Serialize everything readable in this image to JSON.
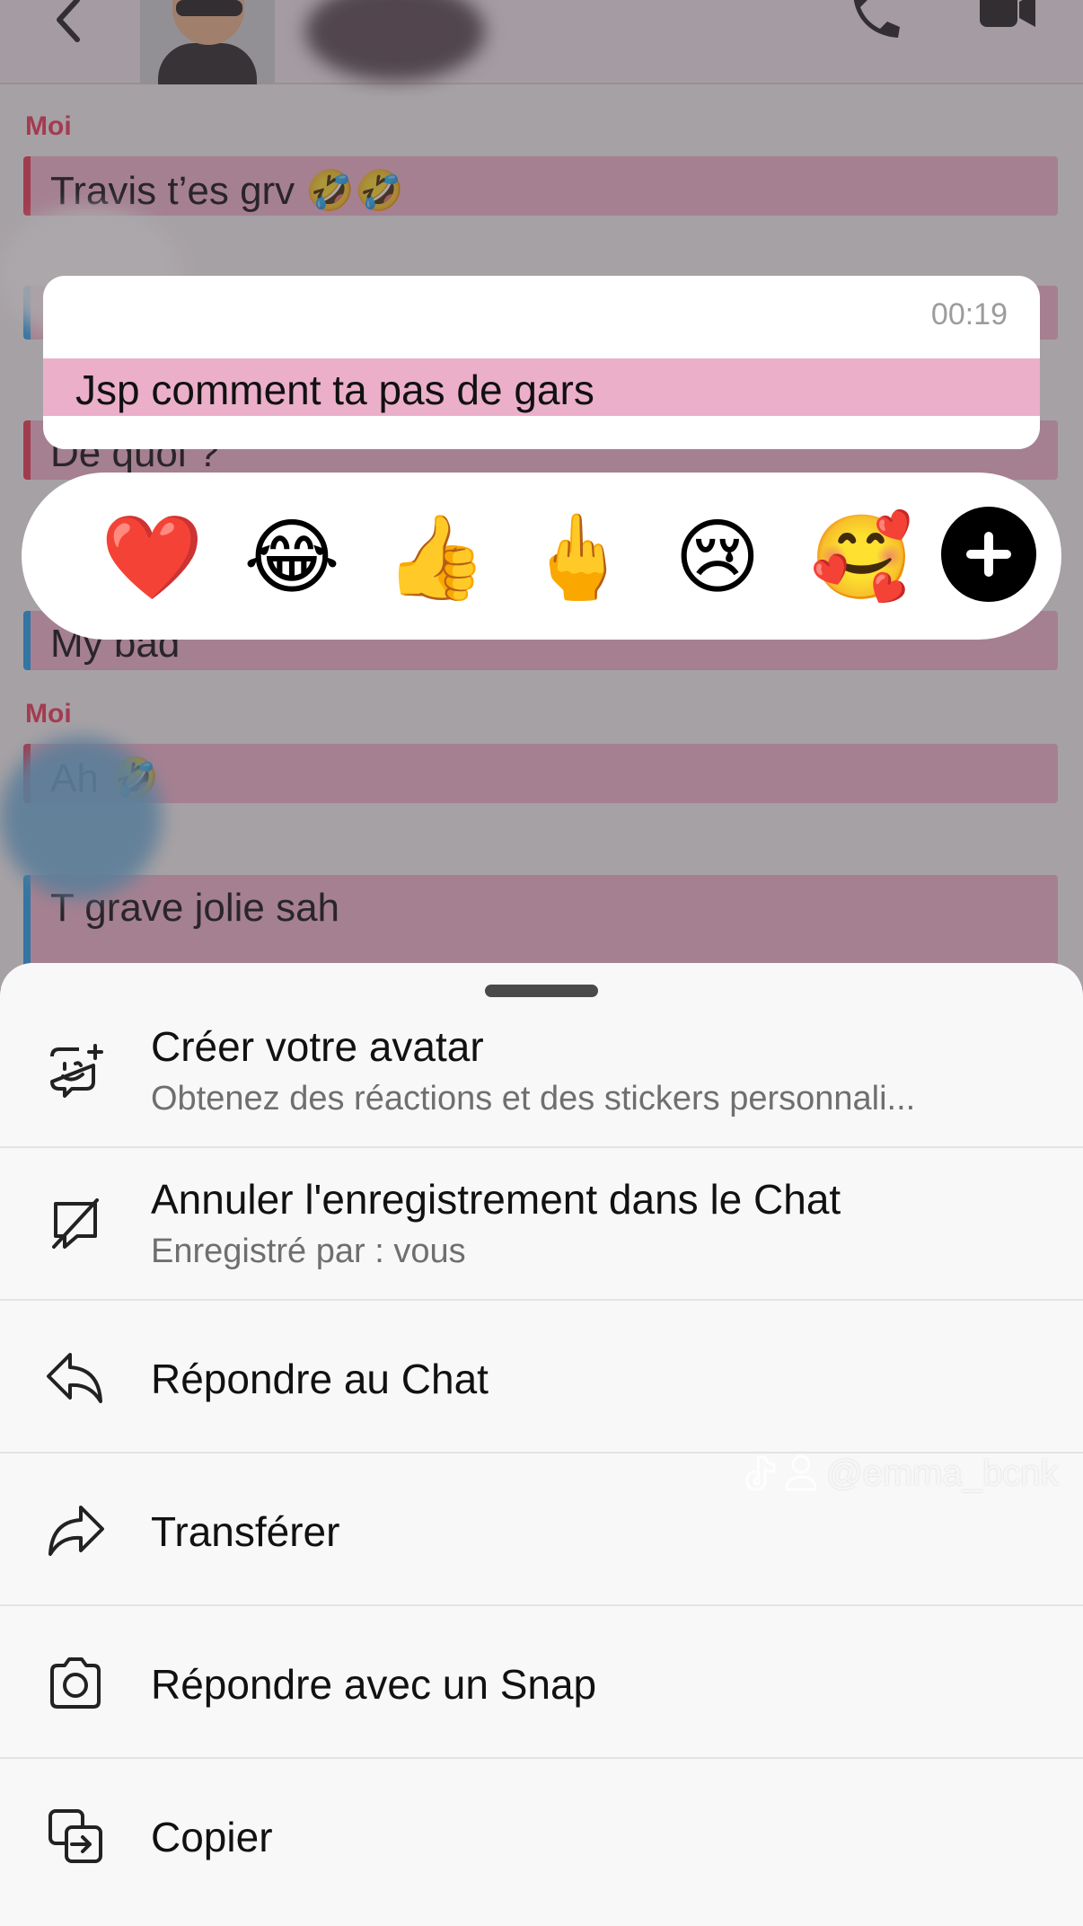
{
  "chat": {
    "messages": [
      {
        "sender": "Moi",
        "text": "Travis t’es grv 🤣🤣"
      },
      {
        "sender": "",
        "text": "De quoi ?"
      },
      {
        "sender": "",
        "text": "My bad"
      },
      {
        "sender": "Moi",
        "text": "Ah 🤣"
      },
      {
        "sender": "",
        "text": "T grave jolie sah"
      }
    ]
  },
  "focused_message": {
    "time": "00:19",
    "text": "Jsp comment ta pas de gars"
  },
  "reactions": [
    "❤️",
    "😂",
    "👍",
    "🖕",
    "😢",
    "🥰"
  ],
  "menu": {
    "items": [
      {
        "title": "Créer votre avatar",
        "subtitle": "Obtenez des réactions et des stickers personnali...",
        "icon": "avatar-smile-icon"
      },
      {
        "title": "Annuler l'enregistrement dans le Chat",
        "subtitle": "Enregistré par : vous",
        "icon": "unsave-bookmark-icon"
      },
      {
        "title": "Répondre au Chat",
        "icon": "reply-arrow-icon"
      },
      {
        "title": "Transférer",
        "icon": "forward-arrow-icon"
      },
      {
        "title": "Répondre avec un Snap",
        "icon": "camera-icon"
      },
      {
        "title": "Copier",
        "icon": "copy-icon"
      }
    ]
  },
  "watermark": "@emma_bcnk",
  "colors": {
    "accent_red": "#ef3a57",
    "accent_blue": "#23a3f0",
    "bubble_pink": "#f2b7cf",
    "sender_red": "#f13a5a"
  }
}
